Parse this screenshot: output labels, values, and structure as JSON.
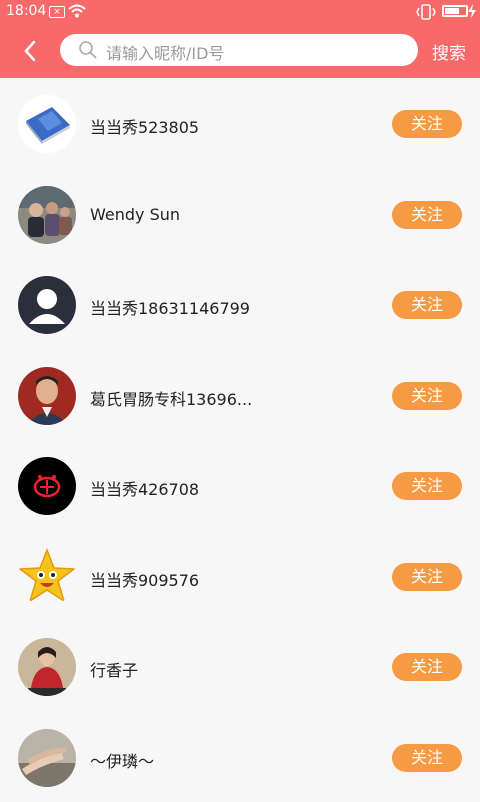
{
  "status_bar": {
    "time": "18:04"
  },
  "header": {
    "search_placeholder": "请输入昵称/ID号",
    "search_button": "搜索"
  },
  "follow_label": "关注",
  "users": [
    {
      "name": "当当秀523805",
      "avatar": "scale-photo"
    },
    {
      "name": "Wendy  Sun",
      "avatar": "people-photo"
    },
    {
      "name": "当当秀18631146799",
      "avatar": "default-person"
    },
    {
      "name": "葛氏胃肠专科13696...",
      "avatar": "man-photo"
    },
    {
      "name": "当当秀426708",
      "avatar": "red-logo"
    },
    {
      "name": "当当秀909576",
      "avatar": "star-face"
    },
    {
      "name": "行香子",
      "avatar": "woman-photo"
    },
    {
      "name": "～伊璘～",
      "avatar": "legs-photo"
    }
  ],
  "colors": {
    "header": "#f86a6a",
    "follow_button": "#f69b43"
  }
}
